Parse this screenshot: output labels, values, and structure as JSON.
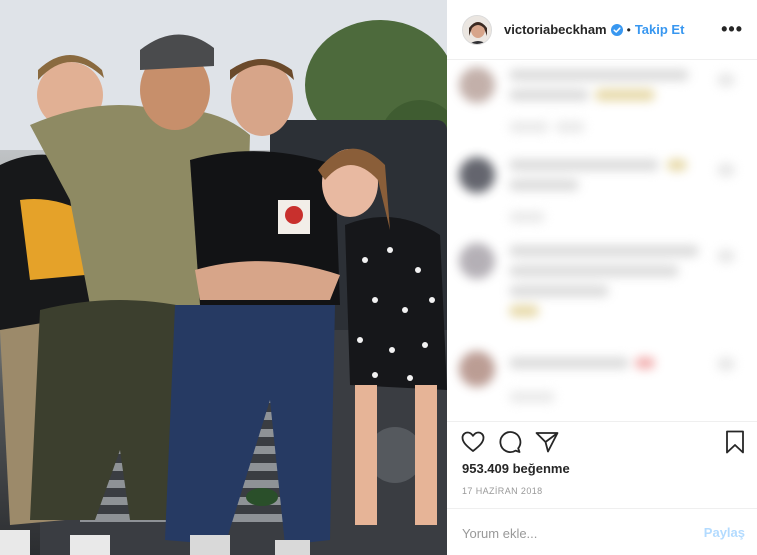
{
  "post": {
    "username": "victoriabeckham",
    "separator": "•",
    "follow_label": "Takip Et",
    "more_label": "•••",
    "likes": "953.409 beğenme",
    "date": "17 HAZİRAN 2018"
  },
  "comment_box": {
    "placeholder": "Yorum ekle...",
    "post_label": "Paylaş"
  },
  "colors": {
    "accent": "#3897f0",
    "verified": "#3897f0",
    "post_disabled": "#b3dbff"
  },
  "icons": {
    "verified": "verified-badge-icon",
    "like": "heart-icon",
    "comment": "comment-bubble-icon",
    "share": "paper-plane-icon",
    "save": "bookmark-icon",
    "more": "ellipsis-icon"
  }
}
